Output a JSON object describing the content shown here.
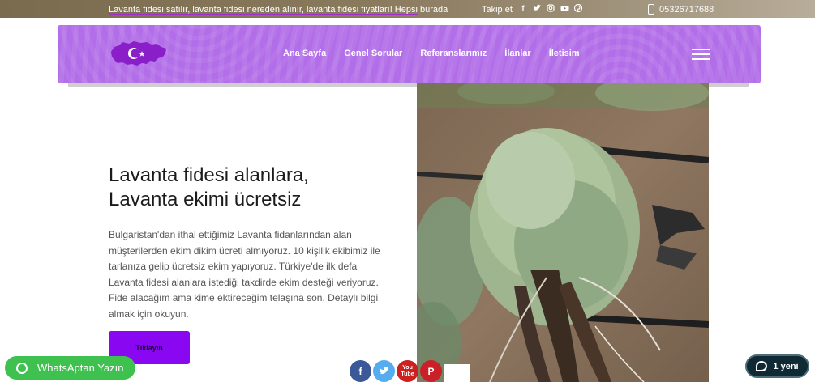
{
  "topbar": {
    "announcement": "Lavanta fidesi satılır, lavanta fidesi nereden alınır, lavanta fidesi fiyatları! Hepsi burada",
    "follow_label": "Takip et",
    "social_icons": [
      "facebook-icon",
      "twitter-icon",
      "instagram-icon",
      "youtube-icon",
      "pinterest-icon"
    ],
    "phone": "05326717688"
  },
  "nav": {
    "items": [
      {
        "label": "Ana Sayfa"
      },
      {
        "label": "Genel Sorular"
      },
      {
        "label": "Referanslarımız"
      },
      {
        "label": "İlanlar"
      },
      {
        "label": "İletisim"
      }
    ],
    "background_color": "#b26ee8"
  },
  "hero": {
    "title_line1": "Lavanta fidesi alanlara,",
    "title_line2": "Lavanta ekimi ücretsiz",
    "body": "Bulgaristan'dan ithal ettiğimiz Lavanta fidanlarından alan müşterilerden ekim dikim ücreti almıyoruz. 10 kişilik ekibimiz ile tarlanıza gelip ücretsiz ekim yapıyoruz. Türkiye'de ilk defa Lavanta fidesi alanlara istediği takdirde ekim desteği veriyoruz. Fide alacağım ama kime ektireceğim telaşına son. Detaylı bilgi almak için okuyun.",
    "cta_label": "Tıklayın",
    "cta_color": "#8a07f2"
  },
  "widgets": {
    "whatsapp_label": "WhatsAptan Yazın",
    "whatsapp_color": "#3ec14f",
    "share_icons": [
      "facebook-icon",
      "twitter-icon",
      "youtube-icon",
      "pinterest-icon"
    ],
    "youtube_text": "You Tube",
    "chat_label": "1 yeni"
  }
}
